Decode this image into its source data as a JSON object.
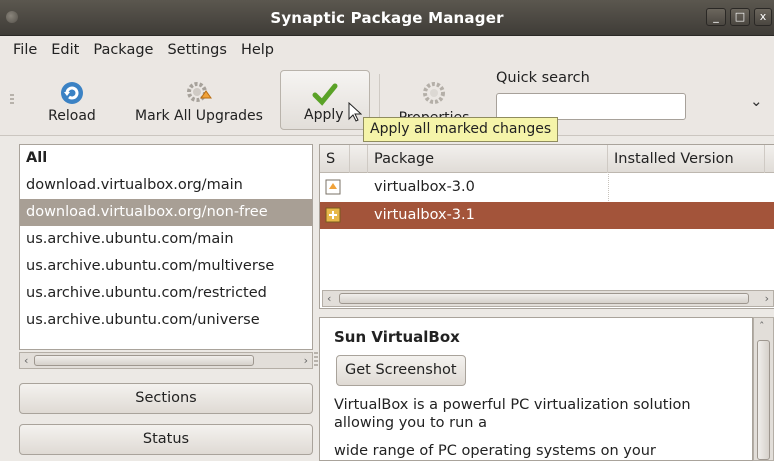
{
  "window": {
    "title": "Synaptic Package Manager",
    "minimize": "_",
    "maximize": "□",
    "close": "x"
  },
  "menu": [
    {
      "label": "File"
    },
    {
      "label": "Edit"
    },
    {
      "label": "Package"
    },
    {
      "label": "Settings"
    },
    {
      "label": "Help"
    }
  ],
  "toolbar": {
    "reload": "Reload",
    "mark_all_upgrades": "Mark All Upgrades",
    "apply": "Apply",
    "properties": "Properties",
    "quick_search_label": "Quick search",
    "quick_search_value": ""
  },
  "tooltip": {
    "text": "Apply all marked changes"
  },
  "repos": [
    {
      "label": "All",
      "bold": true
    },
    {
      "label": "download.virtualbox.org/main"
    },
    {
      "label": "download.virtualbox.org/non-free",
      "selected": true
    },
    {
      "label": "us.archive.ubuntu.com/main"
    },
    {
      "label": "us.archive.ubuntu.com/multiverse"
    },
    {
      "label": "us.archive.ubuntu.com/restricted"
    },
    {
      "label": "us.archive.ubuntu.com/universe"
    }
  ],
  "filter_buttons": {
    "sections": "Sections",
    "status": "Status"
  },
  "packages": {
    "columns": {
      "status": "S",
      "package": "Package",
      "installed_version": "Installed Version"
    },
    "rows": [
      {
        "name": "virtualbox-3.0",
        "installed_version": "",
        "status_icon": "new-package-icon"
      },
      {
        "name": "virtualbox-3.1",
        "installed_version": "",
        "status_icon": "marked-install-icon",
        "selected": true
      }
    ]
  },
  "details": {
    "title": "Sun VirtualBox",
    "screenshot_button": "Get Screenshot",
    "line1": "VirtualBox is a powerful PC virtualization solution allowing you to run a",
    "line2": "wide range of PC operating systems on your"
  },
  "colors": {
    "selection_repo": "#a89f95",
    "selection_package": "#a3543a",
    "tooltip_bg": "#f5f4a9"
  }
}
